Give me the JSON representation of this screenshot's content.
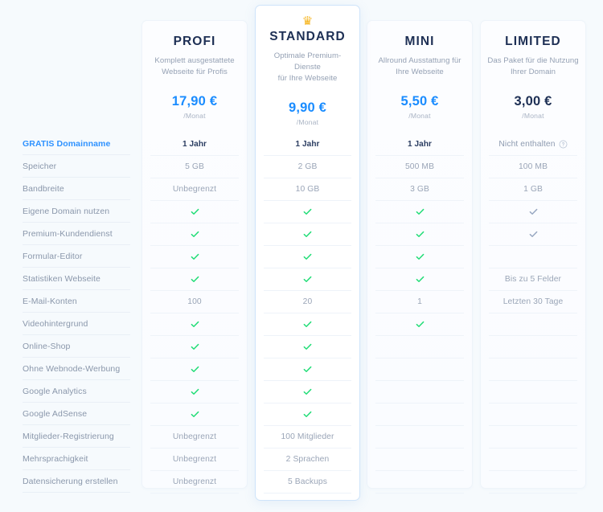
{
  "theme": {
    "background": "#f6fafd",
    "accent_blue": "#1a8cff",
    "navy": "#1d2f54",
    "check_green": "#22dd77",
    "check_grey": "#98a8c2",
    "crown_gold": "#f6b622",
    "label_grey": "#8a97ab"
  },
  "features": [
    {
      "label": "GRATIS Domainname",
      "highlight": true
    },
    {
      "label": "Speicher"
    },
    {
      "label": "Bandbreite"
    },
    {
      "label": "Eigene Domain nutzen"
    },
    {
      "label": "Premium-Kundendienst"
    },
    {
      "label": "Formular-Editor"
    },
    {
      "label": "Statistiken Webseite"
    },
    {
      "label": "E-Mail-Konten"
    },
    {
      "label": "Videohintergrund"
    },
    {
      "label": "Online-Shop"
    },
    {
      "label": "Ohne Webnode-Werbung"
    },
    {
      "label": "Google Analytics"
    },
    {
      "label": "Google AdSense"
    },
    {
      "label": "Mitglieder-Registrierung"
    },
    {
      "label": "Mehrsprachigkeit"
    },
    {
      "label": "Datensicherung erstellen"
    }
  ],
  "plans": [
    {
      "id": "profi",
      "name": "PROFI",
      "description_line1": "Komplett ausgestattete",
      "description_line2": "Webseite für Profis",
      "price": "17,90 €",
      "period": "/Monat",
      "featured": false,
      "price_style": "blue",
      "values": [
        "1 Jahr",
        "5 GB",
        "Unbegrenzt",
        "check",
        "check",
        "check",
        "check",
        "100",
        "check",
        "check",
        "check",
        "check",
        "check",
        "Unbegrenzt",
        "Unbegrenzt",
        "Unbegrenzt"
      ]
    },
    {
      "id": "standard",
      "name": "STANDARD",
      "description_line1": "Optimale Premium-Dienste",
      "description_line2": "für Ihre Webseite",
      "price": "9,90 €",
      "period": "/Monat",
      "featured": true,
      "badge_icon": "crown-icon",
      "price_style": "blue",
      "values": [
        "1 Jahr",
        "2 GB",
        "10 GB",
        "check",
        "check",
        "check",
        "check",
        "20",
        "check",
        "check",
        "check",
        "check",
        "check",
        "100 Mitglieder",
        "2 Sprachen",
        "5 Backups"
      ]
    },
    {
      "id": "mini",
      "name": "MINI",
      "description_line1": "Allround Ausstattung für",
      "description_line2": "Ihre Webseite",
      "price": "5,50 €",
      "period": "/Monat",
      "featured": false,
      "price_style": "blue",
      "values": [
        "1 Jahr",
        "500 MB",
        "3 GB",
        "check",
        "check",
        "check",
        "check",
        "1",
        "check",
        "",
        "",
        "",
        "",
        "",
        "",
        ""
      ]
    },
    {
      "id": "limited",
      "name": "LIMITED",
      "description_line1": "Das Paket für die Nutzung",
      "description_line2": "Ihrer Domain",
      "price": "3,00 €",
      "period": "/Monat",
      "featured": false,
      "price_style": "dark",
      "values": [
        "Nicht enthalten",
        "100 MB",
        "1 GB",
        "check-grey",
        "check-grey",
        "",
        "Bis zu 5 Felder",
        "Letzten 30 Tage",
        "",
        "",
        "",
        "",
        "",
        "",
        "",
        ""
      ],
      "first_row_info_icon": "help-circle-icon",
      "first_row_muted": true
    }
  ]
}
